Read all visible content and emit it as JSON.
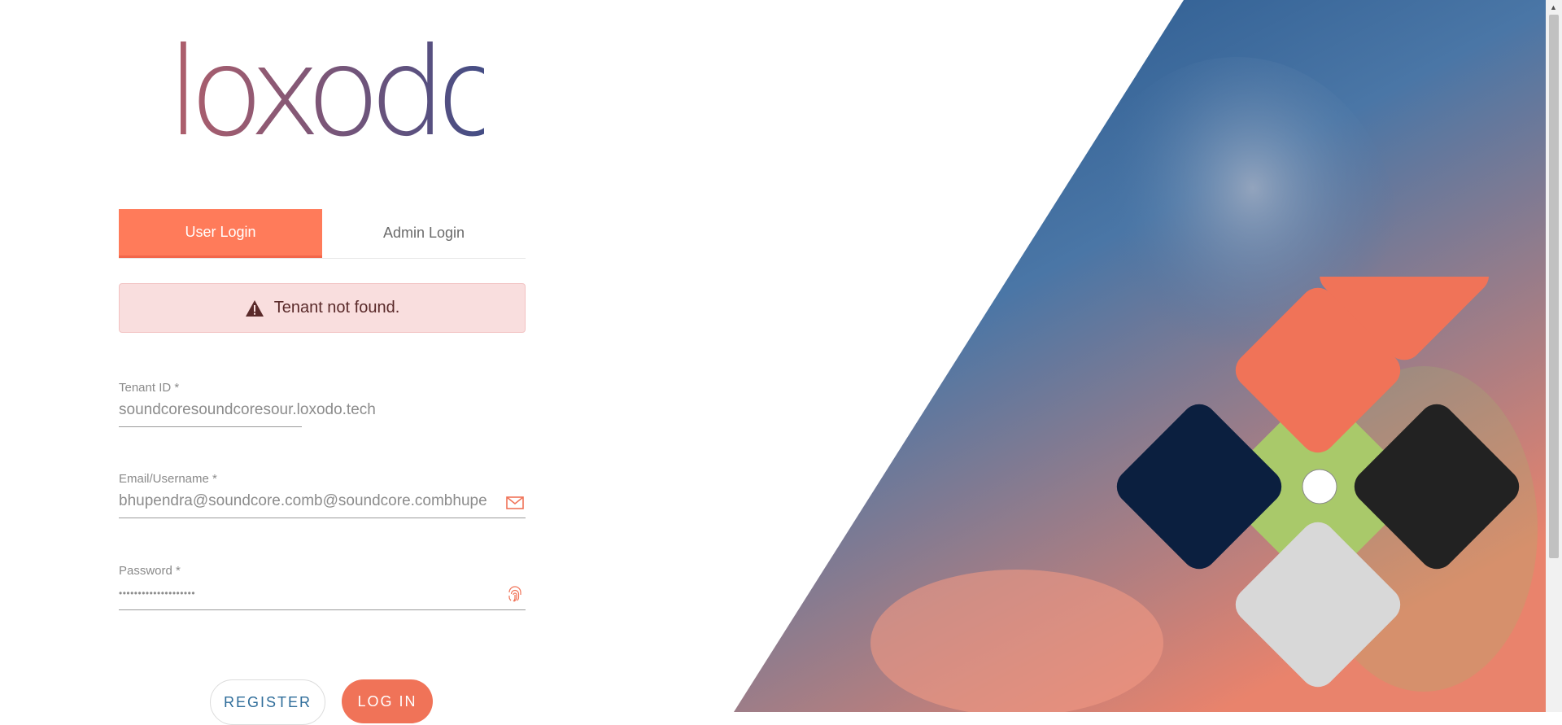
{
  "brand": {
    "logo_text": "loxodo"
  },
  "tabs": [
    {
      "label": "User Login",
      "active": true
    },
    {
      "label": "Admin Login",
      "active": false
    }
  ],
  "alert": {
    "message": "Tenant not found.",
    "icon": "warning-icon"
  },
  "form": {
    "tenant": {
      "label": "Tenant ID *",
      "value": "soundcoresoundcoresour",
      "suffix": ".loxodo.tech"
    },
    "email": {
      "label": "Email/Username *",
      "value": "bhupendra@soundcore.comb@soundcore.combhupe",
      "icon": "mail-icon"
    },
    "password": {
      "label": "Password *",
      "value": "••••••••••••••••••••",
      "icon": "fingerprint-icon"
    }
  },
  "buttons": {
    "register": "REGISTER",
    "login": "LOG IN"
  },
  "colors": {
    "accent": "#ff7b5a",
    "diamond_top": "#f07358",
    "diamond_left": "#0b1f3f",
    "diamond_right": "#222222",
    "diamond_bottom": "#d8d8d8",
    "cross_center": "#a9c96a"
  }
}
